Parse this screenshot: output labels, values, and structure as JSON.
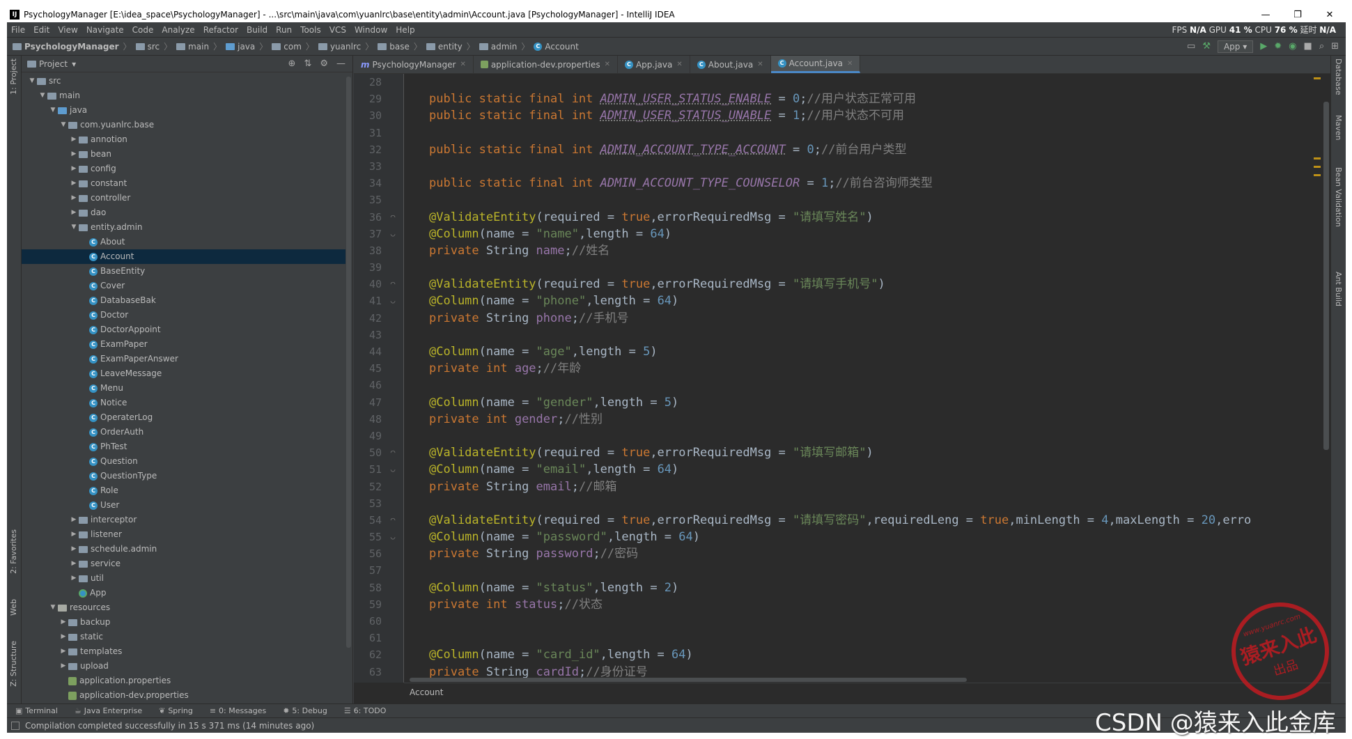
{
  "window": {
    "title": "PsychologyManager [E:\\idea_space\\PsychologyManager] - ...\\src\\main\\java\\com\\yuanlrc\\base\\entity\\admin\\Account.java [PsychologyManager] - IntelliJ IDEA",
    "controls": [
      "—",
      "❐",
      "✕"
    ]
  },
  "menu": [
    "File",
    "Edit",
    "View",
    "Navigate",
    "Code",
    "Analyze",
    "Refactor",
    "Build",
    "Run",
    "Tools",
    "VCS",
    "Window",
    "Help"
  ],
  "perf": {
    "fps_label": "FPS",
    "fps": "N/A",
    "gpu_label": "GPU",
    "gpu": "41 %",
    "cpu_label": "CPU",
    "cpu": "76 %",
    "lat_label": "延时",
    "lat": "N/A"
  },
  "breadcrumb": [
    "PsychologyManager",
    "src",
    "main",
    "java",
    "com",
    "yuanlrc",
    "base",
    "entity",
    "admin",
    "Account"
  ],
  "run_config": "App",
  "project_panel": {
    "title": "Project"
  },
  "tree": [
    {
      "label": "src",
      "depth": 1,
      "arrow": "▼",
      "icon": "folder"
    },
    {
      "label": "main",
      "depth": 2,
      "arrow": "▼",
      "icon": "folder"
    },
    {
      "label": "java",
      "depth": 3,
      "arrow": "▼",
      "icon": "folder-blue"
    },
    {
      "label": "com.yuanlrc.base",
      "depth": 4,
      "arrow": "▼",
      "icon": "folder"
    },
    {
      "label": "annotion",
      "depth": 5,
      "arrow": "▶",
      "icon": "folder"
    },
    {
      "label": "bean",
      "depth": 5,
      "arrow": "▶",
      "icon": "folder"
    },
    {
      "label": "config",
      "depth": 5,
      "arrow": "▶",
      "icon": "folder"
    },
    {
      "label": "constant",
      "depth": 5,
      "arrow": "▶",
      "icon": "folder"
    },
    {
      "label": "controller",
      "depth": 5,
      "arrow": "▶",
      "icon": "folder"
    },
    {
      "label": "dao",
      "depth": 5,
      "arrow": "▶",
      "icon": "folder"
    },
    {
      "label": "entity.admin",
      "depth": 5,
      "arrow": "▼",
      "icon": "folder"
    },
    {
      "label": "About",
      "depth": 6,
      "arrow": "",
      "icon": "class"
    },
    {
      "label": "Account",
      "depth": 6,
      "arrow": "",
      "icon": "class",
      "selected": true
    },
    {
      "label": "BaseEntity",
      "depth": 6,
      "arrow": "",
      "icon": "class"
    },
    {
      "label": "Cover",
      "depth": 6,
      "arrow": "",
      "icon": "class"
    },
    {
      "label": "DatabaseBak",
      "depth": 6,
      "arrow": "",
      "icon": "class"
    },
    {
      "label": "Doctor",
      "depth": 6,
      "arrow": "",
      "icon": "class"
    },
    {
      "label": "DoctorAppoint",
      "depth": 6,
      "arrow": "",
      "icon": "class"
    },
    {
      "label": "ExamPaper",
      "depth": 6,
      "arrow": "",
      "icon": "class"
    },
    {
      "label": "ExamPaperAnswer",
      "depth": 6,
      "arrow": "",
      "icon": "class"
    },
    {
      "label": "LeaveMessage",
      "depth": 6,
      "arrow": "",
      "icon": "class"
    },
    {
      "label": "Menu",
      "depth": 6,
      "arrow": "",
      "icon": "class"
    },
    {
      "label": "Notice",
      "depth": 6,
      "arrow": "",
      "icon": "class"
    },
    {
      "label": "OperaterLog",
      "depth": 6,
      "arrow": "",
      "icon": "class"
    },
    {
      "label": "OrderAuth",
      "depth": 6,
      "arrow": "",
      "icon": "class"
    },
    {
      "label": "PhTest",
      "depth": 6,
      "arrow": "",
      "icon": "class"
    },
    {
      "label": "Question",
      "depth": 6,
      "arrow": "",
      "icon": "class"
    },
    {
      "label": "QuestionType",
      "depth": 6,
      "arrow": "",
      "icon": "class"
    },
    {
      "label": "Role",
      "depth": 6,
      "arrow": "",
      "icon": "class"
    },
    {
      "label": "User",
      "depth": 6,
      "arrow": "",
      "icon": "class"
    },
    {
      "label": "interceptor",
      "depth": 5,
      "arrow": "▶",
      "icon": "folder"
    },
    {
      "label": "listener",
      "depth": 5,
      "arrow": "▶",
      "icon": "folder"
    },
    {
      "label": "schedule.admin",
      "depth": 5,
      "arrow": "▶",
      "icon": "folder"
    },
    {
      "label": "service",
      "depth": 5,
      "arrow": "▶",
      "icon": "folder"
    },
    {
      "label": "util",
      "depth": 5,
      "arrow": "▶",
      "icon": "folder"
    },
    {
      "label": "App",
      "depth": 5,
      "arrow": "",
      "icon": "app"
    },
    {
      "label": "resources",
      "depth": 3,
      "arrow": "▼",
      "icon": "folder-res"
    },
    {
      "label": "backup",
      "depth": 4,
      "arrow": "▶",
      "icon": "folder"
    },
    {
      "label": "static",
      "depth": 4,
      "arrow": "▶",
      "icon": "folder"
    },
    {
      "label": "templates",
      "depth": 4,
      "arrow": "▶",
      "icon": "folder"
    },
    {
      "label": "upload",
      "depth": 4,
      "arrow": "▶",
      "icon": "folder"
    },
    {
      "label": "application.properties",
      "depth": 4,
      "arrow": "",
      "icon": "props"
    },
    {
      "label": "application-dev.properties",
      "depth": 4,
      "arrow": "",
      "icon": "props"
    }
  ],
  "tabs": [
    {
      "label": "PsychologyManager",
      "icon": "m"
    },
    {
      "label": "application-dev.properties",
      "icon": "props"
    },
    {
      "label": "App.java",
      "icon": "class"
    },
    {
      "label": "About.java",
      "icon": "class"
    },
    {
      "label": "Account.java",
      "icon": "class",
      "active": true
    }
  ],
  "code_lines": [
    {
      "n": 28,
      "t": []
    },
    {
      "n": 29,
      "t": [
        [
          "kw",
          "public static final int "
        ],
        [
          "cst-u",
          "ADMIN_USER_STATUS_ENABLE"
        ],
        [
          "p",
          " = "
        ],
        [
          "num-l",
          "0"
        ],
        [
          "p",
          ";"
        ],
        [
          "cmt",
          "//用户状态正常可用"
        ]
      ]
    },
    {
      "n": 30,
      "t": [
        [
          "kw",
          "public static final int "
        ],
        [
          "cst-u",
          "ADMIN_USER_STATUS_UNABLE"
        ],
        [
          "p",
          " = "
        ],
        [
          "num-l",
          "1"
        ],
        [
          "p",
          ";"
        ],
        [
          "cmt",
          "//用户状态不可用"
        ]
      ]
    },
    {
      "n": 31,
      "t": []
    },
    {
      "n": 32,
      "t": [
        [
          "kw",
          "public static final int "
        ],
        [
          "cst-u",
          "ADMIN_ACCOUNT_TYPE_ACCOUNT"
        ],
        [
          "p",
          " = "
        ],
        [
          "num-l",
          "0"
        ],
        [
          "p",
          ";"
        ],
        [
          "cmt",
          "//前台用户类型"
        ]
      ]
    },
    {
      "n": 33,
      "t": []
    },
    {
      "n": 34,
      "t": [
        [
          "kw",
          "public static final int "
        ],
        [
          "cst",
          "ADMIN_ACCOUNT_TYPE_COUNSELOR"
        ],
        [
          "p",
          " = "
        ],
        [
          "num-l",
          "1"
        ],
        [
          "p",
          ";"
        ],
        [
          "cmt",
          "//前台咨询师类型"
        ]
      ]
    },
    {
      "n": 35,
      "t": []
    },
    {
      "n": 36,
      "m": "◠",
      "t": [
        [
          "ann",
          "@ValidateEntity"
        ],
        [
          "p",
          "(required = "
        ],
        [
          "kw",
          "true"
        ],
        [
          "p",
          ",errorRequiredMsg = "
        ],
        [
          "str",
          "\"请填写姓名\""
        ],
        [
          "p",
          ")"
        ]
      ]
    },
    {
      "n": 37,
      "m": "◡",
      "t": [
        [
          "ann",
          "@Column"
        ],
        [
          "p",
          "(name = "
        ],
        [
          "str",
          "\"name\""
        ],
        [
          "p",
          ",length = "
        ],
        [
          "num-l",
          "64"
        ],
        [
          "p",
          ")"
        ]
      ]
    },
    {
      "n": 38,
      "t": [
        [
          "kw",
          "private "
        ],
        [
          "p",
          "String "
        ],
        [
          "fld",
          "name"
        ],
        [
          "p",
          ";"
        ],
        [
          "cmt",
          "//姓名"
        ]
      ]
    },
    {
      "n": 39,
      "t": []
    },
    {
      "n": 40,
      "m": "◠",
      "t": [
        [
          "ann",
          "@ValidateEntity"
        ],
        [
          "p",
          "(required = "
        ],
        [
          "kw",
          "true"
        ],
        [
          "p",
          ",errorRequiredMsg = "
        ],
        [
          "str",
          "\"请填写手机号\""
        ],
        [
          "p",
          ")"
        ]
      ]
    },
    {
      "n": 41,
      "m": "◡",
      "t": [
        [
          "ann",
          "@Column"
        ],
        [
          "p",
          "(name = "
        ],
        [
          "str",
          "\"phone\""
        ],
        [
          "p",
          ",length = "
        ],
        [
          "num-l",
          "64"
        ],
        [
          "p",
          ")"
        ]
      ]
    },
    {
      "n": 42,
      "t": [
        [
          "kw",
          "private "
        ],
        [
          "p",
          "String "
        ],
        [
          "fld",
          "phone"
        ],
        [
          "p",
          ";"
        ],
        [
          "cmt",
          "//手机号"
        ]
      ]
    },
    {
      "n": 43,
      "t": []
    },
    {
      "n": 44,
      "t": [
        [
          "ann",
          "@Column"
        ],
        [
          "p",
          "(name = "
        ],
        [
          "str",
          "\"age\""
        ],
        [
          "p",
          ",length = "
        ],
        [
          "num-l",
          "5"
        ],
        [
          "p",
          ")"
        ]
      ]
    },
    {
      "n": 45,
      "t": [
        [
          "kw",
          "private int "
        ],
        [
          "fld",
          "age"
        ],
        [
          "p",
          ";"
        ],
        [
          "cmt",
          "//年龄"
        ]
      ]
    },
    {
      "n": 46,
      "t": []
    },
    {
      "n": 47,
      "t": [
        [
          "ann",
          "@Column"
        ],
        [
          "p",
          "(name = "
        ],
        [
          "str",
          "\"gender\""
        ],
        [
          "p",
          ",length = "
        ],
        [
          "num-l",
          "5"
        ],
        [
          "p",
          ")"
        ]
      ]
    },
    {
      "n": 48,
      "t": [
        [
          "kw",
          "private int "
        ],
        [
          "fld",
          "gender"
        ],
        [
          "p",
          ";"
        ],
        [
          "cmt",
          "//性别"
        ]
      ]
    },
    {
      "n": 49,
      "t": []
    },
    {
      "n": 50,
      "m": "◠",
      "t": [
        [
          "ann",
          "@ValidateEntity"
        ],
        [
          "p",
          "(required = "
        ],
        [
          "kw",
          "true"
        ],
        [
          "p",
          ",errorRequiredMsg = "
        ],
        [
          "str",
          "\"请填写邮箱\""
        ],
        [
          "p",
          ")"
        ]
      ]
    },
    {
      "n": 51,
      "m": "◡",
      "t": [
        [
          "ann",
          "@Column"
        ],
        [
          "p",
          "(name = "
        ],
        [
          "str",
          "\"email\""
        ],
        [
          "p",
          ",length = "
        ],
        [
          "num-l",
          "64"
        ],
        [
          "p",
          ")"
        ]
      ]
    },
    {
      "n": 52,
      "t": [
        [
          "kw",
          "private "
        ],
        [
          "p",
          "String "
        ],
        [
          "fld",
          "email"
        ],
        [
          "p",
          ";"
        ],
        [
          "cmt",
          "//邮箱"
        ]
      ]
    },
    {
      "n": 53,
      "t": []
    },
    {
      "n": 54,
      "m": "◠",
      "t": [
        [
          "ann",
          "@ValidateEntity"
        ],
        [
          "p",
          "(required = "
        ],
        [
          "kw",
          "true"
        ],
        [
          "p",
          ",errorRequiredMsg = "
        ],
        [
          "str",
          "\"请填写密码\""
        ],
        [
          "p",
          ",requiredLeng = "
        ],
        [
          "kw",
          "true"
        ],
        [
          "p",
          ",minLength = "
        ],
        [
          "num-l",
          "4"
        ],
        [
          "p",
          ",maxLength = "
        ],
        [
          "num-l",
          "20"
        ],
        [
          "p",
          ",erro"
        ]
      ]
    },
    {
      "n": 55,
      "m": "◡",
      "t": [
        [
          "ann",
          "@Column"
        ],
        [
          "p",
          "(name = "
        ],
        [
          "str",
          "\"password\""
        ],
        [
          "p",
          ",length = "
        ],
        [
          "num-l",
          "64"
        ],
        [
          "p",
          ")"
        ]
      ]
    },
    {
      "n": 56,
      "t": [
        [
          "kw",
          "private "
        ],
        [
          "p",
          "String "
        ],
        [
          "fld",
          "password"
        ],
        [
          "p",
          ";"
        ],
        [
          "cmt",
          "//密码"
        ]
      ]
    },
    {
      "n": 57,
      "t": []
    },
    {
      "n": 58,
      "t": [
        [
          "ann",
          "@Column"
        ],
        [
          "p",
          "(name = "
        ],
        [
          "str",
          "\"status\""
        ],
        [
          "p",
          ",length = "
        ],
        [
          "num-l",
          "2"
        ],
        [
          "p",
          ")"
        ]
      ]
    },
    {
      "n": 59,
      "t": [
        [
          "kw",
          "private int "
        ],
        [
          "fld",
          "status"
        ],
        [
          "p",
          ";"
        ],
        [
          "cmt",
          "//状态"
        ]
      ]
    },
    {
      "n": 60,
      "t": []
    },
    {
      "n": 61,
      "t": []
    },
    {
      "n": 62,
      "t": [
        [
          "ann",
          "@Column"
        ],
        [
          "p",
          "(name = "
        ],
        [
          "str",
          "\"card_id\""
        ],
        [
          "p",
          ",length = "
        ],
        [
          "num-l",
          "64"
        ],
        [
          "p",
          ")"
        ]
      ]
    },
    {
      "n": 63,
      "t": [
        [
          "kw",
          "private "
        ],
        [
          "p",
          "String "
        ],
        [
          "fld",
          "cardId"
        ],
        [
          "p",
          ";"
        ],
        [
          "cmt",
          "//身份证号"
        ]
      ]
    }
  ],
  "editor_footer": "Account",
  "left_stripe": [
    "1: Project",
    "2: Favorites",
    "Web",
    "Z: Structure"
  ],
  "right_stripe": [
    "Database",
    "Maven",
    "Bean Validation",
    "Ant Build"
  ],
  "bottom_tools": [
    {
      "label": "Terminal",
      "icon": "▣"
    },
    {
      "label": "Java Enterprise",
      "icon": "☕"
    },
    {
      "label": "Spring",
      "icon": "❦"
    },
    {
      "label": "0: Messages",
      "icon": "≡"
    },
    {
      "label": "5: Debug",
      "icon": "✹"
    },
    {
      "label": "6: TODO",
      "icon": "☰"
    }
  ],
  "status": "Compilation completed successfully in 15 s 371 ms (14 minutes ago)",
  "watermark": {
    "stamp_url": "www.yuanrc.com",
    "stamp_main": "猿来入此",
    "stamp_sub": "出品",
    "csdn": "CSDN @猿来入此金库"
  }
}
